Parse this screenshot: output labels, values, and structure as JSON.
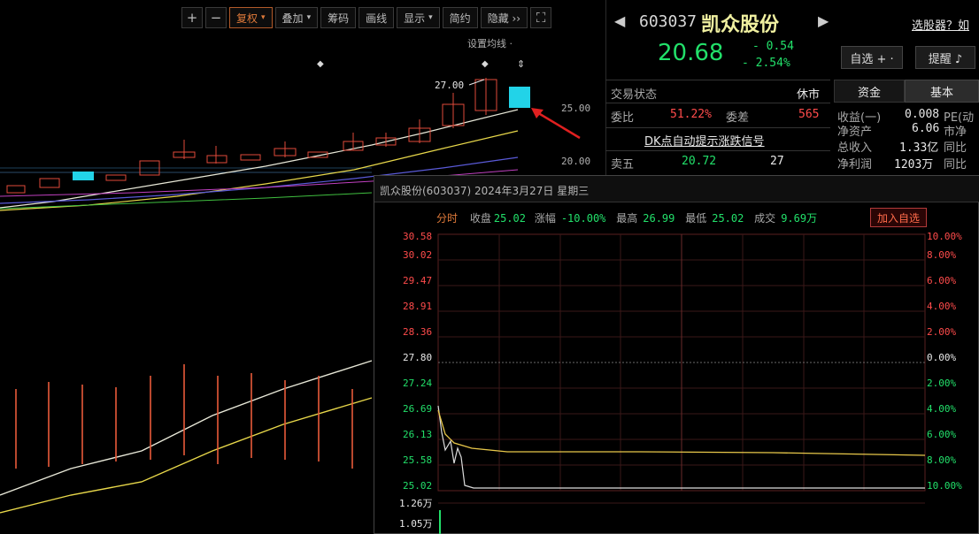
{
  "toolbar": {
    "plus": "+",
    "minus": "−",
    "fuquan": "复权",
    "overlay": "叠加",
    "chips": "筹码",
    "drawline": "画线",
    "display": "显示",
    "simple": "简约",
    "hide": "隐藏 ››",
    "expand": "⛶"
  },
  "chart": {
    "ma_setting": "设置均线 ·",
    "peak_label": "27.00",
    "axis_25": "25.00",
    "axis_20": "20.00"
  },
  "quote": {
    "code": "603037",
    "name": "凯众股份",
    "price": "20.68",
    "change": "- 0.54",
    "change_pct": "- 2.54%",
    "select_stock": "选股器？如",
    "watchlist_btn": "自选 + ·",
    "alert_btn": "提醒 ♪",
    "trade_status_label": "交易状态",
    "trade_status_value": "休市",
    "tab_fund": "资金",
    "tab_basic": "基本",
    "webi_label": "委比",
    "webi_value": "51.22%",
    "weicha_label": "委差",
    "weicha_value": "565",
    "dk_signal": "DK点自动提示涨跌信号",
    "ask5_label": "卖五",
    "ask5_price": "20.72",
    "ask5_vol": "27",
    "basic": [
      {
        "label": "收益(一)",
        "value": "0.008",
        "extra": "PE(动"
      },
      {
        "label": "净资产",
        "value": "6.06",
        "extra": "市净"
      },
      {
        "label": "总收入",
        "value": "1.33亿",
        "extra": "同比"
      },
      {
        "label": "净利润",
        "value": "1203万",
        "extra": "同比"
      }
    ]
  },
  "popup": {
    "title": "凯众股份(603037) 2024年3月27日 星期三",
    "tab": "分时",
    "close_label": "收盘",
    "close_value": "25.02",
    "change_label": "涨幅",
    "change_value": "-10.00%",
    "high_label": "最高",
    "high_value": "26.99",
    "low_label": "最低",
    "low_value": "25.02",
    "vol_label": "成交",
    "vol_value": "9.69万",
    "add_btn": "加入自选",
    "left_axis": [
      "30.58",
      "30.02",
      "29.47",
      "28.91",
      "28.36",
      "27.80",
      "27.24",
      "26.69",
      "26.13",
      "25.58",
      "25.02"
    ],
    "right_axis": [
      "10.00%",
      "8.00%",
      "6.00%",
      "4.00%",
      "2.00%",
      "0.00%",
      "2.00%",
      "4.00%",
      "6.00%",
      "8.00%",
      "10.00%"
    ],
    "vol_axis": [
      "1.26万",
      "1.05万"
    ]
  },
  "colors": {
    "up": "#ff4b4b",
    "down": "#22e06a",
    "accent": "#e07a3a",
    "highlight": "#22d3e8"
  }
}
